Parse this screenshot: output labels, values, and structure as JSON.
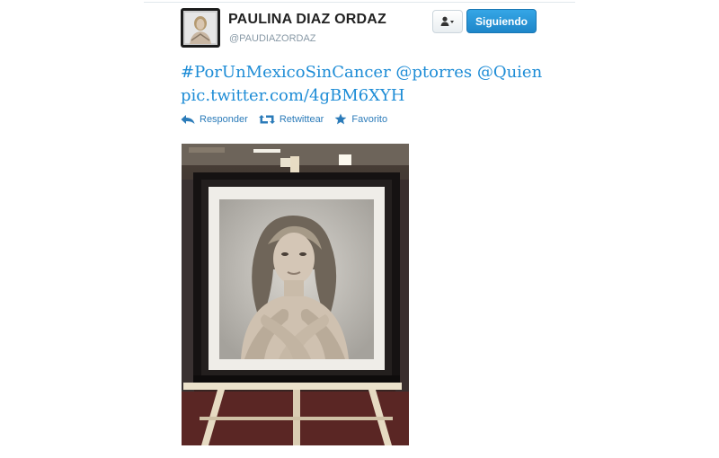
{
  "profile": {
    "name": "PAULINA DIAZ ORDAZ",
    "handle": "@PAUDIAZORDAZ"
  },
  "buttons": {
    "user_menu_icon": "person-icon",
    "follow_label": "Siguiendo"
  },
  "tweet": {
    "line1": "#PorUnMexicoSinCancer @ptorres @Quien",
    "line2": "pic.twitter.com/4gBM6XYH"
  },
  "actions": {
    "reply": "Responder",
    "retweet": "Retwittear",
    "favorite": "Favorito"
  },
  "colors": {
    "link": "#1d8cd6",
    "action": "#2b7bb9",
    "follow_button": "#2596dd"
  }
}
